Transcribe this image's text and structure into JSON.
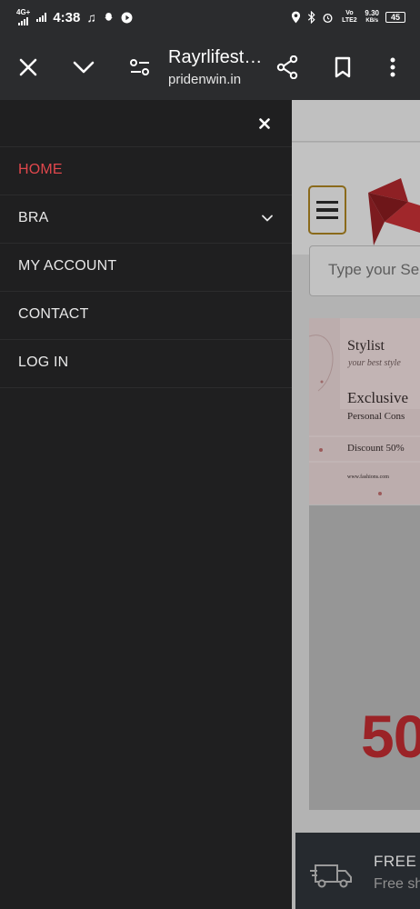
{
  "status_bar": {
    "network": "4G+",
    "time": "4:38",
    "volte": "Vo LTE2",
    "speed_value": "9.30",
    "speed_unit": "KB/s",
    "battery": "45"
  },
  "browser": {
    "title": "Rayrlifest…",
    "domain": "pridenwin.in",
    "icons": [
      "close-icon",
      "chevron-down-icon",
      "tune-icon",
      "share-icon",
      "bookmark-icon",
      "more-vert-icon"
    ]
  },
  "drawer": {
    "close_icon": "close-icon",
    "items": [
      {
        "label": "HOME",
        "active": true
      },
      {
        "label": "BRA",
        "has_submenu": true
      },
      {
        "label": "MY ACCOUNT"
      },
      {
        "label": "CONTACT"
      },
      {
        "label": "LOG IN"
      }
    ],
    "active_color": "#e0474c"
  },
  "site": {
    "search_placeholder": "Type your Se",
    "banner": {
      "line1": "Stylist",
      "script": "your best style",
      "line2": "Exclusive",
      "line3": "Personal Cons",
      "line4": "Discount 50%",
      "url": "www.fashions.com"
    },
    "promo_big": "50",
    "footer": {
      "title": "FREE SH",
      "subtitle": "Free sh"
    }
  }
}
